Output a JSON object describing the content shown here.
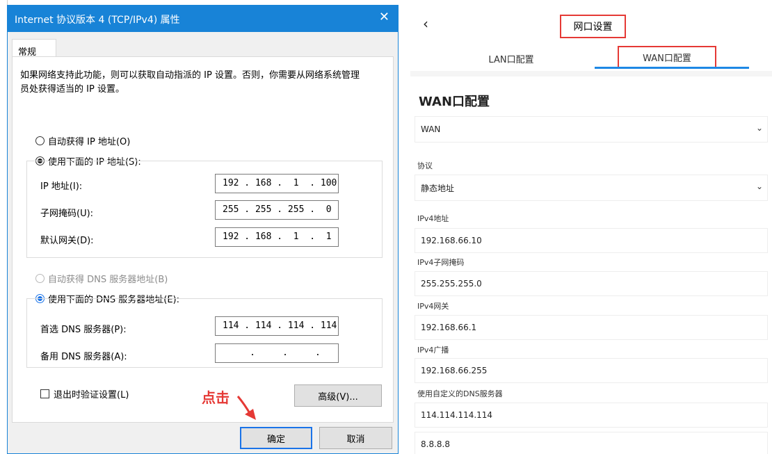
{
  "dialog": {
    "title": "Internet 协议版本 4 (TCP/IPv4) 属性",
    "close_glyph": "✕",
    "tab": "常规",
    "description": "如果网络支持此功能，则可以获取自动指派的 IP 设置。否则，你需要从网络系统管理员处获得适当的 IP 设置。",
    "auto_ip_label": "自动获得 IP 地址(O)",
    "manual_ip_label": "使用下面的 IP 地址(S):",
    "ip_label": "IP 地址(I):",
    "ip_value": "192 . 168 .  1  . 100",
    "mask_label": "子网掩码(U):",
    "mask_value": "255 . 255 . 255 .  0",
    "gateway_label": "默认网关(D):",
    "gateway_value": "192 . 168 .  1  .  1",
    "auto_dns_label": "自动获得 DNS 服务器地址(B)",
    "manual_dns_label": "使用下面的 DNS 服务器地址(E):",
    "pref_dns_label": "首选 DNS 服务器(P):",
    "pref_dns_value": "114 . 114 . 114 . 114",
    "alt_dns_label": "备用 DNS 服务器(A):",
    "alt_dns_value": "     .     .     .",
    "validate_label": "退出时验证设置(L)",
    "advanced_label": "高级(V)...",
    "ok_label": "确定",
    "cancel_label": "取消",
    "annotation": "点击"
  },
  "router": {
    "back_glyph": "‹",
    "page_title": "网口设置",
    "tab_lan": "LAN口配置",
    "tab_wan": "WAN口配置",
    "section_title": "WAN口配置",
    "interface_value": "WAN",
    "protocol_label": "协议",
    "protocol_value": "静态地址",
    "ipv4_label": "IPv4地址",
    "ipv4_value": "192.168.66.10",
    "mask_label": "IPv4子网掩码",
    "mask_value": "255.255.255.0",
    "gateway_label": "IPv4网关",
    "gateway_value": "192.168.66.1",
    "broadcast_label": "IPv4广播",
    "broadcast_value": "192.168.66.255",
    "dns_label": "使用自定义的DNS服务器",
    "dns1_value": "114.114.114.114",
    "dns2_value": "8.8.8.8",
    "caret_glyph": "⌄"
  },
  "colors": {
    "win_accent": "#1883d7",
    "highlight": "#e53935",
    "tab_underline": "#1e88e5"
  }
}
